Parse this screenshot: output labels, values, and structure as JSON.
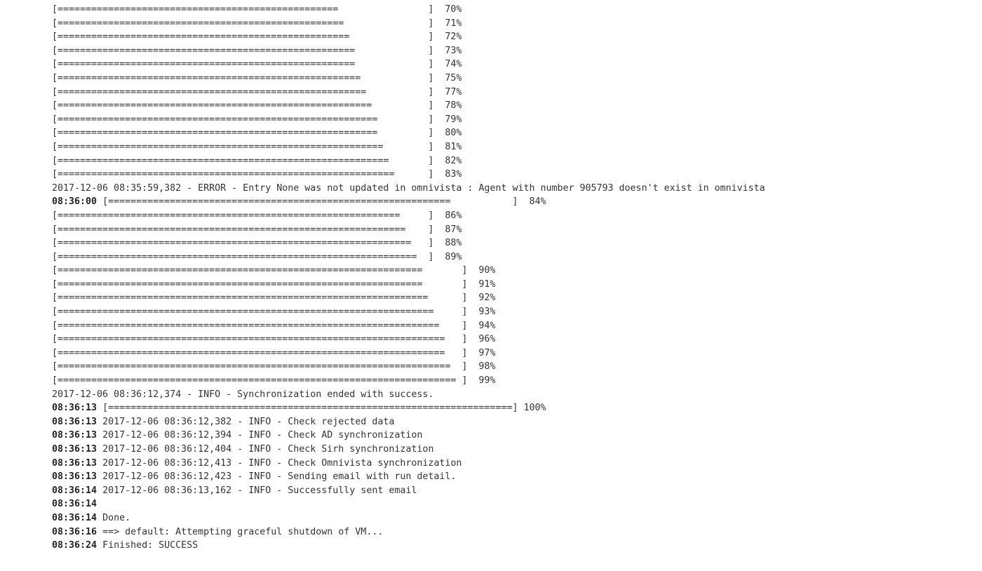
{
  "console": {
    "lines": [
      {
        "ts": "",
        "text": "[==================================================                ]  70%"
      },
      {
        "ts": "",
        "text": "[===================================================               ]  71%"
      },
      {
        "ts": "",
        "text": "[====================================================              ]  72%"
      },
      {
        "ts": "",
        "text": "[=====================================================             ]  73%"
      },
      {
        "ts": "",
        "text": "[=====================================================             ]  74%"
      },
      {
        "ts": "",
        "text": "[======================================================            ]  75%"
      },
      {
        "ts": "",
        "text": "[=======================================================           ]  77%"
      },
      {
        "ts": "",
        "text": "[========================================================          ]  78%"
      },
      {
        "ts": "",
        "text": "[=========================================================         ]  79%"
      },
      {
        "ts": "",
        "text": "[=========================================================         ]  80%"
      },
      {
        "ts": "",
        "text": "[==========================================================        ]  81%"
      },
      {
        "ts": "",
        "text": "[===========================================================       ]  82%"
      },
      {
        "ts": "",
        "text": "[============================================================      ]  83%"
      },
      {
        "ts": "",
        "text": "2017-12-06 08:35:59,382 - ERROR - Entry None was not updated in omnivista : Agent with number 905793 doesn't exist in omnivista"
      },
      {
        "ts": "08:36:00",
        "text": "[=============================================================           ]  84%"
      },
      {
        "ts": "",
        "text": "[=============================================================     ]  86%"
      },
      {
        "ts": "",
        "text": "[==============================================================    ]  87%"
      },
      {
        "ts": "",
        "text": "[===============================================================   ]  88%"
      },
      {
        "ts": "",
        "text": "[================================================================  ]  89%"
      },
      {
        "ts": "",
        "text": "[=================================================================       ]  90%"
      },
      {
        "ts": "",
        "text": "[=================================================================       ]  91%"
      },
      {
        "ts": "",
        "text": "[==================================================================      ]  92%"
      },
      {
        "ts": "",
        "text": "[===================================================================     ]  93%"
      },
      {
        "ts": "",
        "text": "[====================================================================    ]  94%"
      },
      {
        "ts": "",
        "text": "[=====================================================================   ]  96%"
      },
      {
        "ts": "",
        "text": "[=====================================================================   ]  97%"
      },
      {
        "ts": "",
        "text": "[======================================================================  ]  98%"
      },
      {
        "ts": "",
        "text": "[======================================================================= ]  99%"
      },
      {
        "ts": "",
        "text": "2017-12-06 08:36:12,374 - INFO - Synchronization ended with success."
      },
      {
        "ts": "08:36:13",
        "text": "[========================================================================] 100%"
      },
      {
        "ts": "08:36:13",
        "text": "2017-12-06 08:36:12,382 - INFO - Check rejected data"
      },
      {
        "ts": "08:36:13",
        "text": "2017-12-06 08:36:12,394 - INFO - Check AD synchronization"
      },
      {
        "ts": "08:36:13",
        "text": "2017-12-06 08:36:12,404 - INFO - Check Sirh synchronization"
      },
      {
        "ts": "08:36:13",
        "text": "2017-12-06 08:36:12,413 - INFO - Check Omnivista synchronization"
      },
      {
        "ts": "08:36:13",
        "text": "2017-12-06 08:36:12,423 - INFO - Sending email with run detail."
      },
      {
        "ts": "08:36:14",
        "text": "2017-12-06 08:36:13,162 - INFO - Successfully sent email"
      },
      {
        "ts": "08:36:14",
        "text": ""
      },
      {
        "ts": "08:36:14",
        "text": "Done."
      },
      {
        "ts": "08:36:16",
        "text": "==> default: Attempting graceful shutdown of VM..."
      },
      {
        "ts": "08:36:24",
        "text": "Finished: SUCCESS"
      }
    ]
  }
}
